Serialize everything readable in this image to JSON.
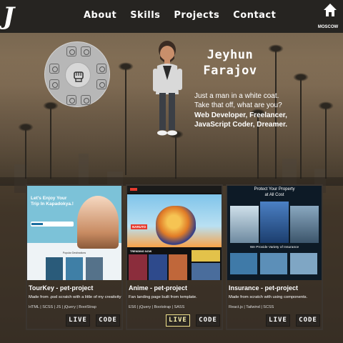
{
  "nav": {
    "logo": "J",
    "items": [
      {
        "label": "About"
      },
      {
        "label": "Skills"
      },
      {
        "label": "Projects"
      },
      {
        "label": "Contact"
      }
    ],
    "location": "MOSCOW"
  },
  "skills_wheel": {
    "center_icon": "fist-icon",
    "items": [
      {
        "label": "JS",
        "icon": "js-icon"
      },
      {
        "label": "CSS",
        "icon": "css-icon"
      },
      {
        "label": "React",
        "icon": "react-icon"
      },
      {
        "label": "Git",
        "icon": "git-icon"
      },
      {
        "label": "HTML",
        "icon": "html-icon"
      },
      {
        "label": "Sass",
        "icon": "sass-icon"
      },
      {
        "label": "WordPress",
        "icon": "wordpress-icon"
      },
      {
        "label": "jQuery",
        "icon": "jquery-icon"
      }
    ]
  },
  "intro": {
    "name_first": "Jeyhun",
    "name_last": "Farajov",
    "tagline_1": "Just a man in a white coat.",
    "tagline_2": "Take that off, what are you?",
    "roles_1": "Web Developer, Freelancer,",
    "roles_2": "JavaScript Coder, Dreamer."
  },
  "projects": [
    {
      "title": "TourKey - pet-project",
      "description": "Made from .psd scratch with a little of my creativity",
      "tech": "HTML | SCSS | JS | jQuery | BootStrap",
      "live_label": "LIVE",
      "code_label": "CODE",
      "thumb_headline_1": "Let's Enjoy Your",
      "thumb_headline_2": "Trip In Kapadokya.!",
      "thumb_section": "Popular Destinations"
    },
    {
      "title": "Anime - pet-project",
      "description": "Fan landing page built from template.",
      "tech": "ES6 | jQuery | Bootstrap | SASS",
      "live_label": "LIVE",
      "code_label": "CODE",
      "thumb_logo": "NARUTO",
      "thumb_section": "TRENDING NOW"
    },
    {
      "title": "Insurance - pet-project",
      "description": "Made from scratch with using components.",
      "tech": "React.js | Tailwind | SCSS",
      "live_label": "LIVE",
      "code_label": "CODE",
      "thumb_headline_1": "Protect Your Property",
      "thumb_headline_2": "at All Cost",
      "thumb_section": "We Provide Variety of Insurance"
    }
  ],
  "colors": {
    "nav_bg": "#262421",
    "live_highlight": "#f1e38c",
    "button_bg": "#2a2622"
  }
}
